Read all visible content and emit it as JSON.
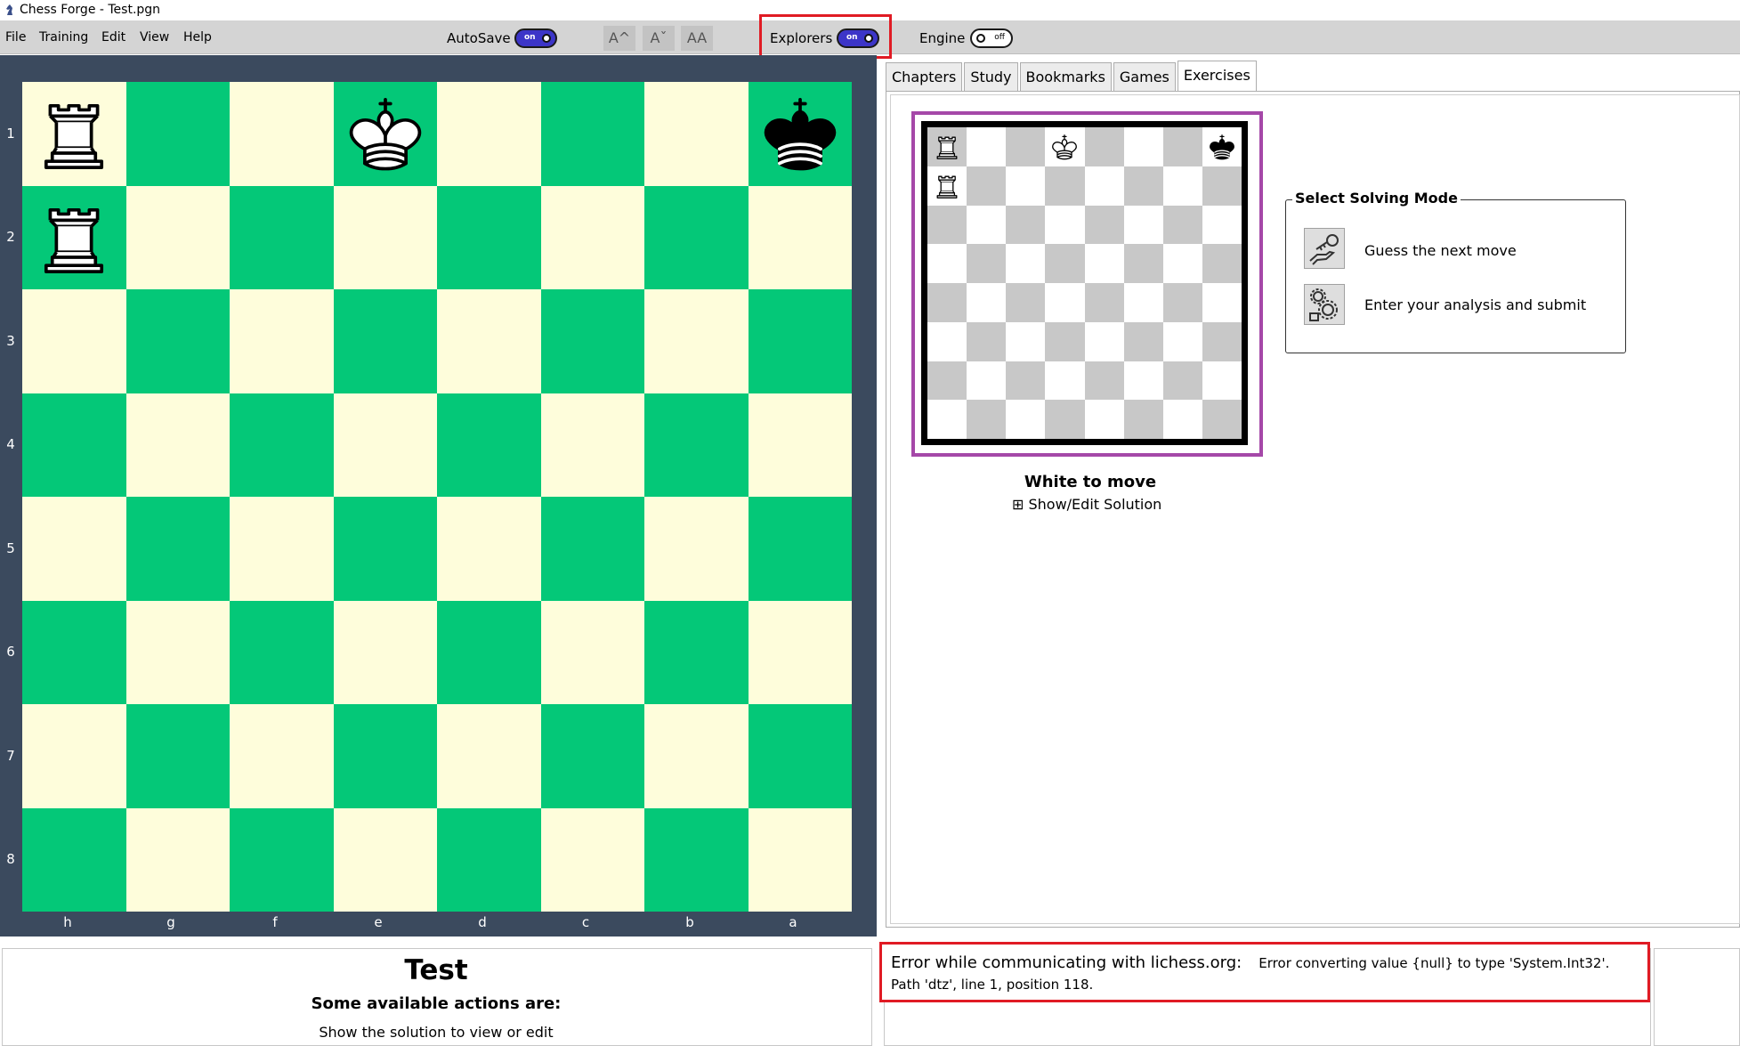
{
  "window": {
    "title": "Chess Forge - Test.pgn"
  },
  "menu": {
    "items": [
      "File",
      "Training",
      "Edit",
      "View",
      "Help"
    ]
  },
  "toolbar": {
    "autosave_label": "AutoSave",
    "autosave_state": "on",
    "font_buttons": [
      "A^",
      "Aˇ",
      "AA"
    ],
    "explorers_label": "Explorers",
    "explorers_state": "on",
    "engine_label": "Engine",
    "engine_state": "off"
  },
  "board": {
    "ranks": [
      "1",
      "2",
      "3",
      "4",
      "5",
      "6",
      "7",
      "8"
    ],
    "files": [
      "h",
      "g",
      "f",
      "e",
      "d",
      "c",
      "b",
      "a"
    ],
    "pieces": [
      {
        "name": "white-rook",
        "file": "h",
        "rank": "1",
        "color": "white",
        "type": "rook"
      },
      {
        "name": "white-rook",
        "file": "h",
        "rank": "2",
        "color": "white",
        "type": "rook"
      },
      {
        "name": "white-king",
        "file": "e",
        "rank": "1",
        "color": "white",
        "type": "king"
      },
      {
        "name": "black-king",
        "file": "a",
        "rank": "1",
        "color": "black",
        "type": "king"
      }
    ],
    "colors": {
      "light": "#fefddb",
      "dark": "#04c878",
      "frame": "#3b4a5e"
    }
  },
  "tabs": [
    {
      "label": "Chapters",
      "active": false
    },
    {
      "label": "Study",
      "active": false
    },
    {
      "label": "Bookmarks",
      "active": false
    },
    {
      "label": "Games",
      "active": false
    },
    {
      "label": "Exercises",
      "active": true
    }
  ],
  "exercise": {
    "side_to_move": "White to move",
    "show_solution": "⊞ Show/Edit Solution",
    "solving_mode": {
      "title": "Select Solving Mode",
      "options": [
        {
          "label": "Guess the next move",
          "icon": "hand-key-icon"
        },
        {
          "label": "Enter your analysis and submit",
          "icon": "gears-icon"
        }
      ]
    }
  },
  "bottom": {
    "title": "Test",
    "subtitle": "Some available actions are:",
    "line1": "Show the solution to view or edit"
  },
  "error": {
    "heading": "Error while communicating with lichess.org:",
    "message": "Error converting value {null} to type 'System.Int32'. Path 'dtz', line 1, position 118."
  }
}
